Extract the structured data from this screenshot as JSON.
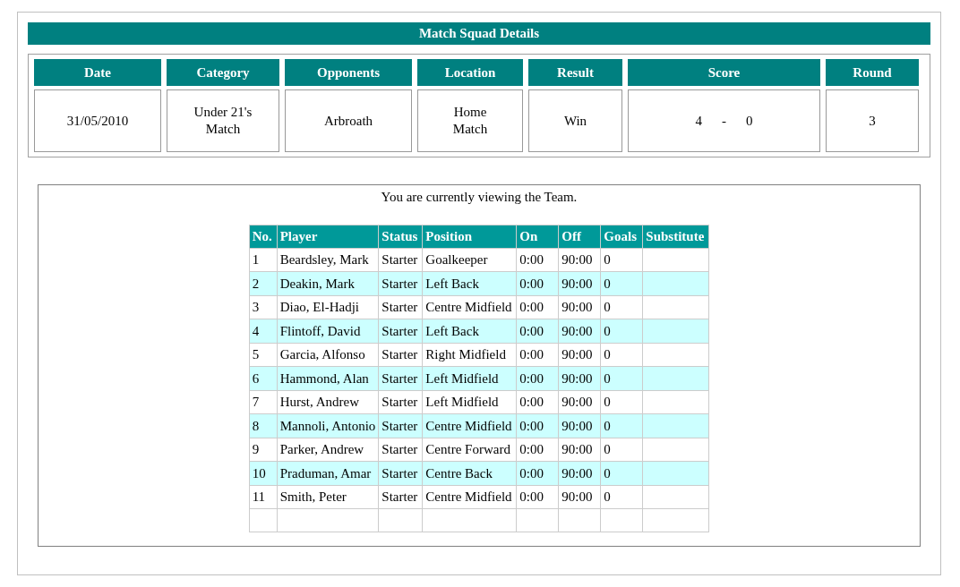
{
  "title": "Match Squad Details",
  "match": {
    "columns": [
      "Date",
      "Category",
      "Opponents",
      "Location",
      "Result",
      "Score",
      "Round"
    ],
    "date": "31/05/2010",
    "category": "Under 21's Match",
    "opponents": "Arbroath",
    "location": "Home Match",
    "result": "Win",
    "score": {
      "home": "4",
      "separator": "-",
      "away": "0"
    },
    "round": "3"
  },
  "team": {
    "caption": "You are currently viewing the Team.",
    "columns": [
      "No.",
      "Player",
      "Status",
      "Position",
      "On",
      "Off",
      "Goals",
      "Substitute"
    ],
    "rows": [
      {
        "no": "1",
        "player": "Beardsley, Mark",
        "status": "Starter",
        "position": "Goalkeeper",
        "on": "0:00",
        "off": "90:00",
        "goals": "0"
      },
      {
        "no": "2",
        "player": "Deakin, Mark",
        "status": "Starter",
        "position": "Left Back",
        "on": "0:00",
        "off": "90:00",
        "goals": "0"
      },
      {
        "no": "3",
        "player": "Diao, El-Hadji",
        "status": "Starter",
        "position": "Centre Midfield",
        "on": "0:00",
        "off": "90:00",
        "goals": "0"
      },
      {
        "no": "4",
        "player": "Flintoff, David",
        "status": "Starter",
        "position": "Left Back",
        "on": "0:00",
        "off": "90:00",
        "goals": "0"
      },
      {
        "no": "5",
        "player": "Garcia, Alfonso",
        "status": "Starter",
        "position": "Right Midfield",
        "on": "0:00",
        "off": "90:00",
        "goals": "0"
      },
      {
        "no": "6",
        "player": "Hammond, Alan",
        "status": "Starter",
        "position": "Left Midfield",
        "on": "0:00",
        "off": "90:00",
        "goals": "0"
      },
      {
        "no": "7",
        "player": "Hurst, Andrew",
        "status": "Starter",
        "position": "Left Midfield",
        "on": "0:00",
        "off": "90:00",
        "goals": "0"
      },
      {
        "no": "8",
        "player": "Mannoli, Antonio",
        "status": "Starter",
        "position": "Centre Midfield",
        "on": "0:00",
        "off": "90:00",
        "goals": "0"
      },
      {
        "no": "9",
        "player": "Parker, Andrew",
        "status": "Starter",
        "position": "Centre Forward",
        "on": "0:00",
        "off": "90:00",
        "goals": "0"
      },
      {
        "no": "10",
        "player": "Praduman, Amar",
        "status": "Starter",
        "position": "Centre Back",
        "on": "0:00",
        "off": "90:00",
        "goals": "0"
      },
      {
        "no": "11",
        "player": "Smith, Peter",
        "status": "Starter",
        "position": "Centre Midfield",
        "on": "0:00",
        "off": "90:00",
        "goals": "0"
      }
    ]
  }
}
